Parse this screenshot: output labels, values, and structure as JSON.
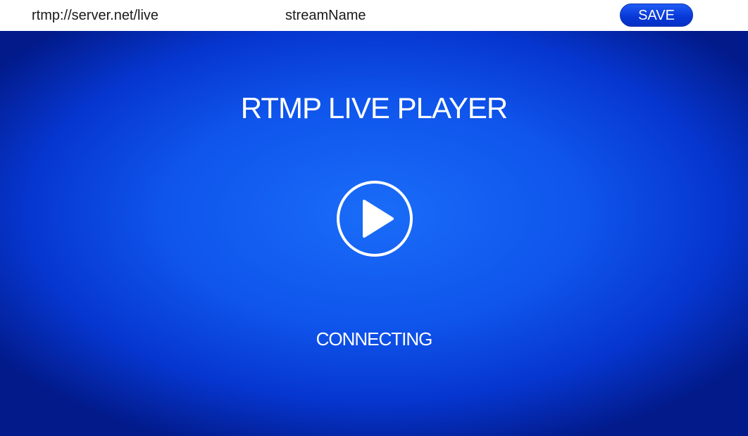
{
  "toolbar": {
    "server_url": "rtmp://server.net/live",
    "stream_name": "streamName",
    "save_label": "SAVE"
  },
  "player": {
    "title": "RTMP LIVE PLAYER",
    "play_icon": "play-icon",
    "status": "CONNECTING"
  },
  "colors": {
    "accent": "#0837d6",
    "background_center": "#1a6cf8",
    "background_edge": "#021a8a",
    "text": "#ffffff"
  }
}
